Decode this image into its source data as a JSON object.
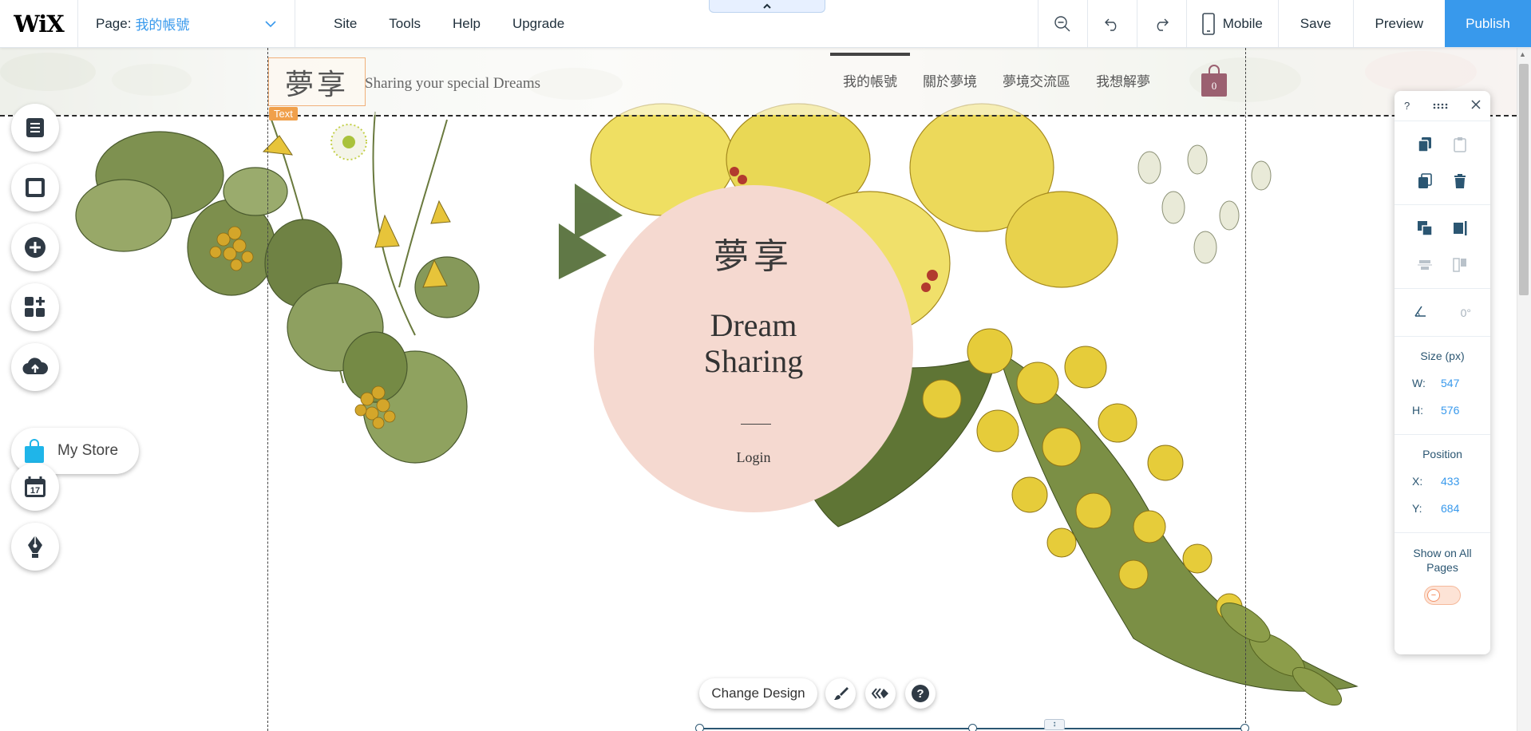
{
  "topbar": {
    "logo": "WiX",
    "page_label": "Page:",
    "page_name": "我的帳號",
    "menu": [
      "Site",
      "Tools",
      "Help",
      "Upgrade"
    ],
    "mobile_label": "Mobile",
    "save_label": "Save",
    "preview_label": "Preview",
    "publish_label": "Publish"
  },
  "site": {
    "logo_text": "夢享",
    "tagline": "Sharing your special Dreams",
    "nav": [
      "我的帳號",
      "關於夢境",
      "夢境交流區",
      "我想解夢"
    ],
    "cart_count": "0",
    "text_tag": "Text"
  },
  "hero": {
    "logo_text": "夢享",
    "title_line1": "Dream",
    "title_line2": "Sharing",
    "login": "Login"
  },
  "left_rail": {
    "store_label": "My Store"
  },
  "inspector": {
    "help": "?",
    "rotation": "0°",
    "size_title": "Size (px)",
    "w_label": "W:",
    "w_value": "547",
    "h_label": "H:",
    "h_value": "576",
    "position_title": "Position",
    "x_label": "X:",
    "x_value": "433",
    "y_label": "Y:",
    "y_value": "684",
    "show_on_all_pages": "Show on All Pages",
    "toggle_symbol": "−"
  },
  "bottom": {
    "change_design": "Change Design"
  },
  "colors": {
    "accent": "#3899ec",
    "circle": "#f5d9d0",
    "text_tag": "#f0a04b"
  }
}
